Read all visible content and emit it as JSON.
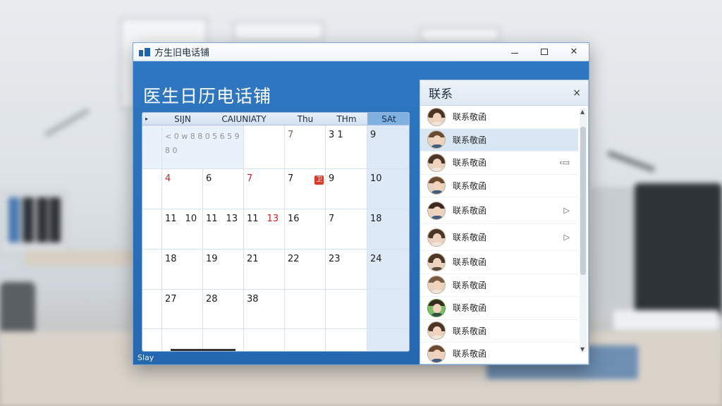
{
  "window": {
    "title": "方生旧电话铺",
    "minimize_label": "",
    "close_label": "✕"
  },
  "header": {
    "title": "医生日历电话铺"
  },
  "calendar": {
    "headers": [
      "SIJN",
      "CAIUNIATY",
      "Thu",
      "THm",
      "SAt"
    ],
    "rows": [
      {
        "gutter": "",
        "cells": [
          "< 0 w 8 8 0 5 6 5 9 8 0",
          "",
          "7",
          "3 1",
          "9"
        ]
      },
      {
        "gutter": "",
        "cells": [
          "4",
          "6",
          "7",
          "7",
          "9",
          "10"
        ]
      },
      {
        "gutter": "",
        "cells": [
          "11",
          "10",
          "11",
          "13",
          "11",
          "13",
          "16",
          "7",
          "18"
        ]
      },
      {
        "gutter": "",
        "cells": [
          "18",
          "19",
          "21",
          "22",
          "23",
          "24"
        ]
      },
      {
        "gutter": "",
        "cells": [
          "27",
          "28",
          "38"
        ]
      }
    ],
    "badge": "卫"
  },
  "status": {
    "text": "Slay"
  },
  "contacts": {
    "title": "联系",
    "close": "×",
    "items": [
      {
        "name": "联系敬函"
      },
      {
        "name": "联系敬函"
      },
      {
        "name": "联系敬函"
      },
      {
        "name": "联系敬函"
      },
      {
        "name": "联系敬函"
      },
      {
        "name": "联系敬函"
      },
      {
        "name": "联系敬函"
      },
      {
        "name": "联系敬函"
      },
      {
        "name": "联系敬函"
      },
      {
        "name": "联系敬函"
      },
      {
        "name": "联系敬函"
      }
    ]
  },
  "colors": {
    "window_blue": "#2f78c2",
    "saturday_header": "#7fb0df",
    "holiday_red": "#d32020"
  }
}
